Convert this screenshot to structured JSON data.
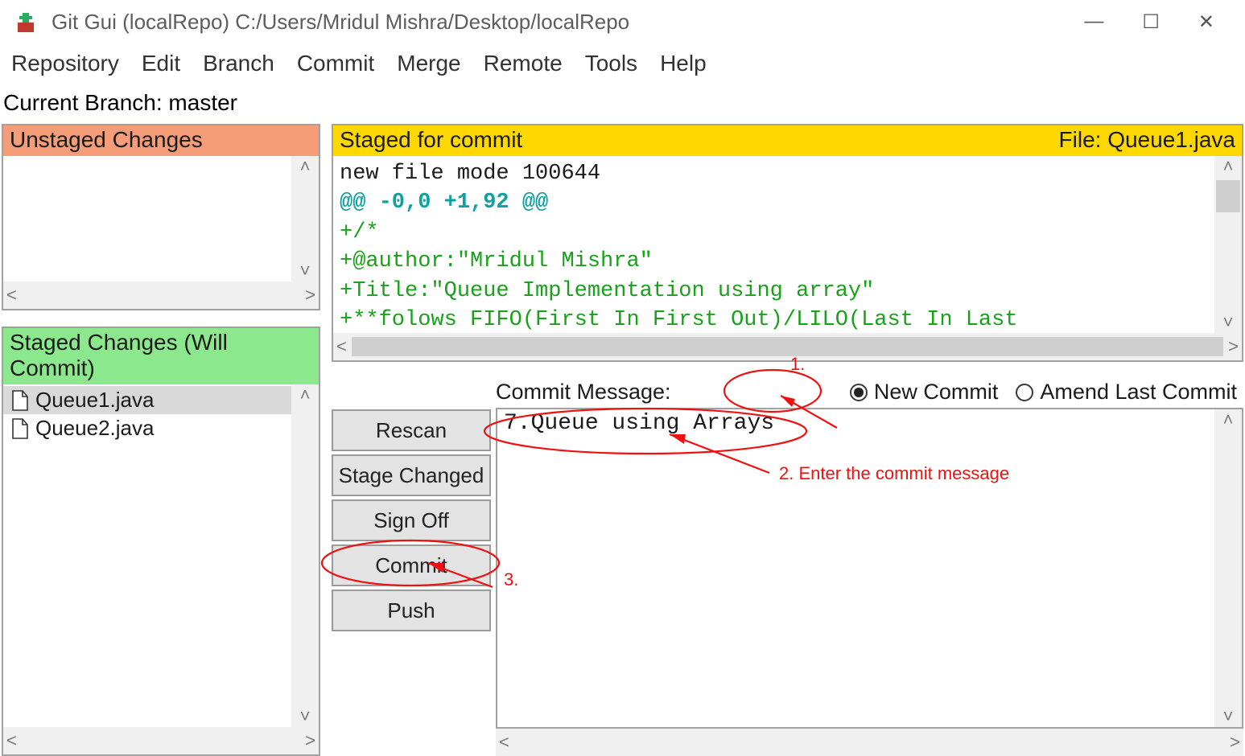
{
  "window": {
    "title": "Git Gui (localRepo) C:/Users/Mridul Mishra/Desktop/localRepo"
  },
  "menu": {
    "items": [
      "Repository",
      "Edit",
      "Branch",
      "Commit",
      "Merge",
      "Remote",
      "Tools",
      "Help"
    ]
  },
  "branch_line": "Current Branch: master",
  "unstaged": {
    "header": "Unstaged Changes",
    "files": []
  },
  "staged": {
    "header": "Staged Changes (Will Commit)",
    "files": [
      "Queue1.java",
      "Queue2.java"
    ]
  },
  "diff": {
    "header_left": "Staged for commit",
    "header_right": "File:  Queue1.java",
    "lines": [
      {
        "cls": "",
        "t": "new file mode 100644"
      },
      {
        "cls": "hunk",
        "t": "@@ -0,0 +1,92 @@"
      },
      {
        "cls": "add",
        "t": "+/*"
      },
      {
        "cls": "add",
        "t": "+@author:\"Mridul Mishra\""
      },
      {
        "cls": "add",
        "t": "+Title:\"Queue Implementation using array\""
      },
      {
        "cls": "add",
        "t": "+**folows FIFO(First In First Out)/LILO(Last In Last"
      }
    ]
  },
  "commit": {
    "label": "Commit Message:",
    "radio_new": "New Commit",
    "radio_amend": "Amend Last Commit",
    "message": "7.Queue using Arrays",
    "buttons": {
      "rescan": "Rescan",
      "stage": "Stage Changed",
      "signoff": "Sign Off",
      "commit": "Commit",
      "push": "Push"
    }
  },
  "annotations": {
    "n1": "1.",
    "n2": "2. Enter the commit message",
    "n3": "3."
  }
}
